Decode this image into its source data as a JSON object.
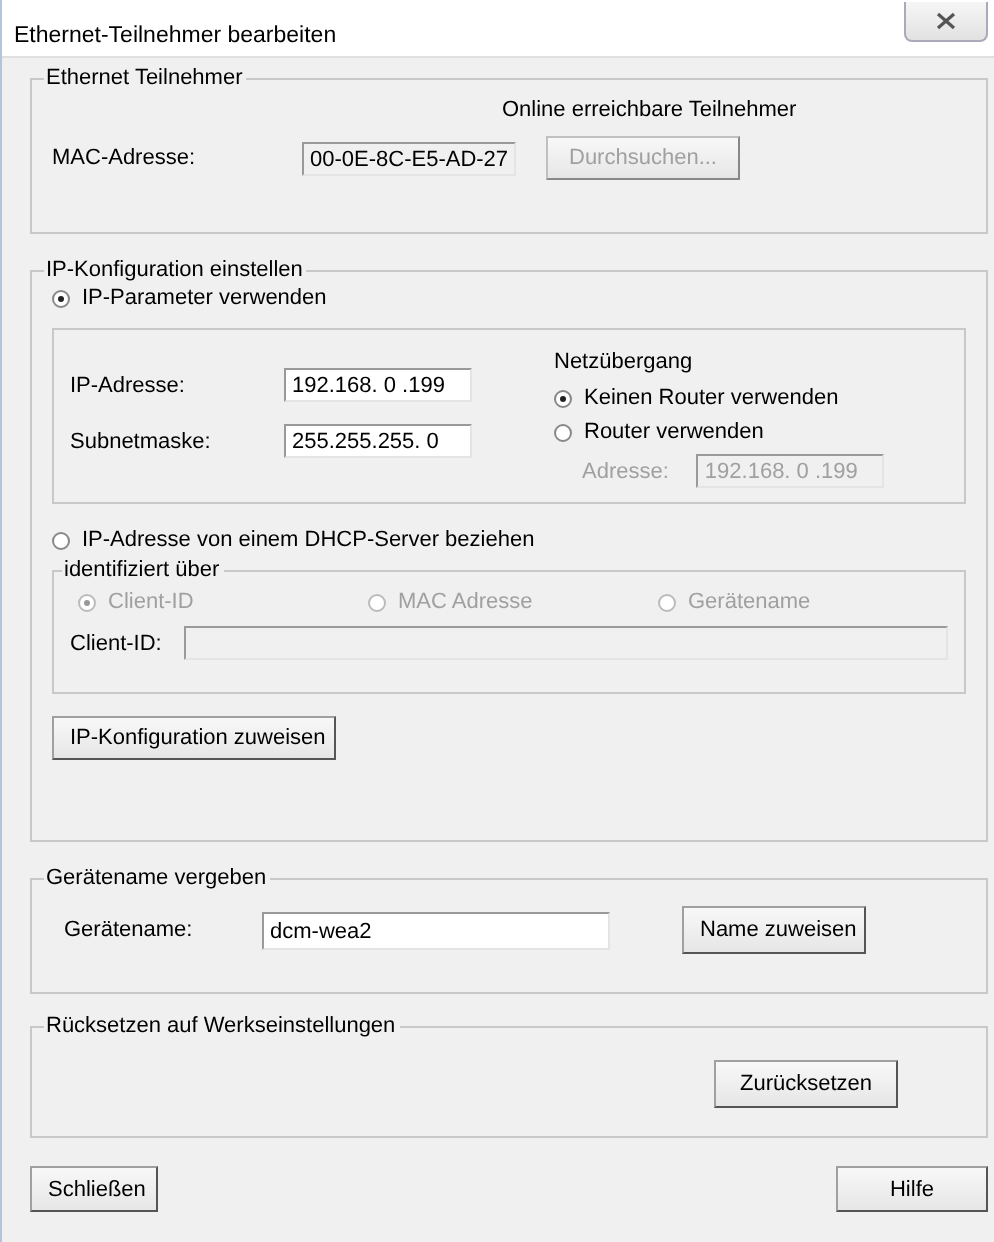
{
  "window": {
    "title": "Ethernet-Teilnehmer bearbeiten"
  },
  "ethernet_station": {
    "legend": "Ethernet Teilnehmer",
    "mac_label": "MAC-Adresse:",
    "mac_value": "00-0E-8C-E5-AD-27",
    "online_label": "Online erreichbare Teilnehmer",
    "browse_button": {
      "label": "Durchsuchen...",
      "disabled": true
    }
  },
  "ip_config": {
    "legend": "IP-Konfiguration einstellen",
    "use_ip_params": {
      "label": "IP-Parameter verwenden",
      "selected": true
    },
    "ip_label": "IP-Adresse:",
    "ip_value": "192.168. 0 .199",
    "subnet_label": "Subnetmaske:",
    "subnet_value": "255.255.255. 0",
    "gateway": {
      "heading": "Netzübergang",
      "options": [
        {
          "label": "Keinen Router verwenden",
          "selected": true
        },
        {
          "label": "Router verwenden",
          "selected": false
        }
      ],
      "address_label": "Adresse:",
      "address_value": "192.168. 0 .199",
      "disabled": true
    },
    "use_dhcp": {
      "label": "IP-Adresse von einem DHCP-Server beziehen",
      "selected": false
    },
    "identified_by": {
      "legend": "identifiziert über",
      "disabled": true,
      "options": [
        {
          "label": "Client-ID",
          "selected": true
        },
        {
          "label": "MAC Adresse",
          "selected": false
        },
        {
          "label": "Gerätename",
          "selected": false
        }
      ],
      "client_id_label": "Client-ID:"
    },
    "assign_button": "IP-Konfiguration zuweisen"
  },
  "device_name": {
    "legend": "Gerätename vergeben",
    "label": "Gerätename:",
    "value": "dcm-wea2",
    "button": "Name zuweisen"
  },
  "factory_reset": {
    "legend": "Rücksetzen auf Werkseinstellungen",
    "button": "Zurücksetzen"
  },
  "footer_buttons": [
    "Schließen",
    "Hilfe"
  ]
}
